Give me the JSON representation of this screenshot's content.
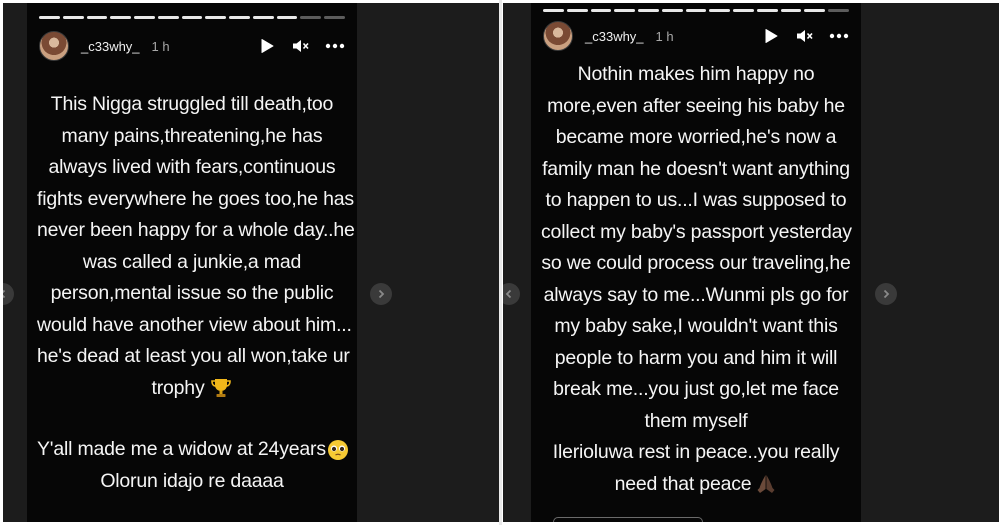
{
  "left_story": {
    "username": "_c33why_",
    "time": "1 h",
    "progress_total": 13,
    "progress_active": 11,
    "caption_lines": [
      "This Nigga struggled till death,too",
      "many pains,threatening,he has",
      "always lived with fears,continuous",
      "fights everywhere he goes too,he has",
      "never been happy for a whole day..he",
      "was called a junkie,a mad",
      "person,mental issue so the public",
      "would have another view about him...",
      "he's dead at least you all won,take ur",
      "trophy"
    ],
    "caption_lines_2": [
      "Y'all made me a widow at 24years",
      "Olorun idajo re daaaa"
    ],
    "emoji_1": "trophy-emoji",
    "emoji_2": "pleading-face-emoji"
  },
  "right_story": {
    "username": "_c33why_",
    "time": "1 h",
    "progress_total": 13,
    "progress_active": 12,
    "caption_lines": [
      "Nothin makes him happy no",
      "more,even after seeing his baby he",
      "became more worried,he's now a",
      "family man he doesn't want anything",
      "to happen to us...I was supposed to",
      "collect my baby's passport yesterday",
      "so we could process our traveling,he",
      "always say to me...Wunmi pls go for",
      "my baby sake,I wouldn't want this",
      "people to harm you and him it will",
      "break me...you just go,let me face",
      "them myself",
      "Ilerioluwa rest in peace..you really",
      "need that peace"
    ],
    "emoji": "praying-hands-emoji"
  },
  "icons": {
    "play": "play-icon",
    "mute": "muted-speaker-icon",
    "more": "more-options-icon",
    "next": "chevron-right-icon",
    "prev": "chevron-left-icon"
  }
}
